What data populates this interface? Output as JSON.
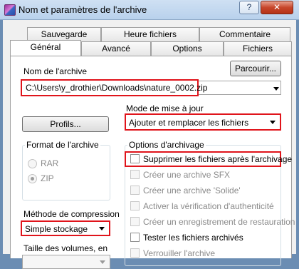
{
  "window": {
    "title": "Nom et paramètres de l'archive",
    "help_label": "?",
    "close_label": "✕"
  },
  "tabs": {
    "row_back": [
      "Sauvegarde",
      "Heure fichiers",
      "Commentaire"
    ],
    "row_front": [
      "Général",
      "Avancé",
      "Options",
      "Fichiers"
    ],
    "active": "Général"
  },
  "archive_name": {
    "label": "Nom de l'archive",
    "value": "C:\\Users\\y_drothier\\Downloads\\nature_0002.zip",
    "browse_label": "Parcourir..."
  },
  "update_mode": {
    "label": "Mode de mise à jour",
    "value": "Ajouter et remplacer les fichiers"
  },
  "profiles_label": "Profils...",
  "archive_format": {
    "label": "Format de l'archive",
    "options": [
      "RAR",
      "ZIP"
    ],
    "selected": "ZIP"
  },
  "compression": {
    "label": "Méthode de compression",
    "value": "Simple stockage"
  },
  "volume_size": {
    "label": "Taille des volumes, en"
  },
  "archiving_options": {
    "label": "Options d'archivage",
    "items": [
      {
        "label": "Supprimer les fichiers après l'archivage",
        "enabled": true,
        "checked": false
      },
      {
        "label": "Créer une archive SFX",
        "enabled": false,
        "checked": false
      },
      {
        "label": "Créer une archive 'Solide'",
        "enabled": false,
        "checked": false
      },
      {
        "label": "Activer la vérification d'authenticité",
        "enabled": false,
        "checked": false
      },
      {
        "label": "Créer un enregistrement de restauration",
        "enabled": false,
        "checked": false
      },
      {
        "label": "Tester les fichiers archivés",
        "enabled": true,
        "checked": false
      },
      {
        "label": "Verrouiller l'archive",
        "enabled": false,
        "checked": false
      }
    ]
  },
  "colors": {
    "highlight_red": "#e0141b",
    "titlebar": "#cfe0f3",
    "close_button": "#c7462b"
  }
}
